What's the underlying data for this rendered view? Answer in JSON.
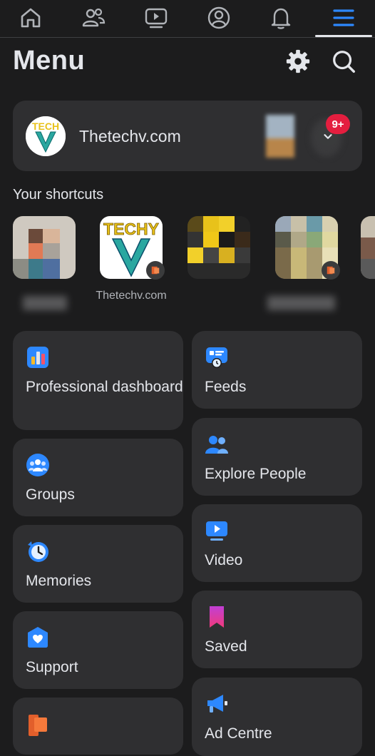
{
  "nav": {
    "tabs": [
      {
        "icon": "home-icon"
      },
      {
        "icon": "friends-icon"
      },
      {
        "icon": "watch-icon"
      },
      {
        "icon": "profile-icon"
      },
      {
        "icon": "bell-icon"
      },
      {
        "icon": "menu-icon",
        "active": true
      }
    ]
  },
  "header": {
    "title": "Menu",
    "settings_icon": "gear-icon",
    "search_icon": "search-icon"
  },
  "profile": {
    "name": "Thetechv.com",
    "avatar_text": "TECHY",
    "notification_count": "9+",
    "expand_icon": "chevron-down-icon"
  },
  "shortcuts": {
    "title": "Your shortcuts",
    "items": [
      {
        "label": ""
      },
      {
        "label": "Thetechv.com",
        "logo_text": "TECHY"
      },
      {
        "label": ""
      },
      {
        "label": ""
      },
      {
        "label": ""
      }
    ]
  },
  "menu": {
    "left": [
      {
        "label": "Professional dashboard",
        "icon": "bar-chart-icon"
      },
      {
        "label": "Groups",
        "icon": "groups-icon"
      },
      {
        "label": "Memories",
        "icon": "clock-icon"
      },
      {
        "label": "Support",
        "icon": "heart-shield-icon"
      },
      {
        "label": "",
        "icon": "flag-icon"
      }
    ],
    "right": [
      {
        "label": "Feeds",
        "icon": "feeds-icon"
      },
      {
        "label": "Explore People",
        "icon": "people-icon"
      },
      {
        "label": "Video",
        "icon": "video-icon"
      },
      {
        "label": "Saved",
        "icon": "bookmark-icon"
      },
      {
        "label": "Ad Centre",
        "icon": "megaphone-icon"
      }
    ]
  },
  "colors": {
    "accent": "#2d88ff",
    "background": "#1c1c1d",
    "card": "#2f2f31",
    "badge": "#e41e3f"
  }
}
